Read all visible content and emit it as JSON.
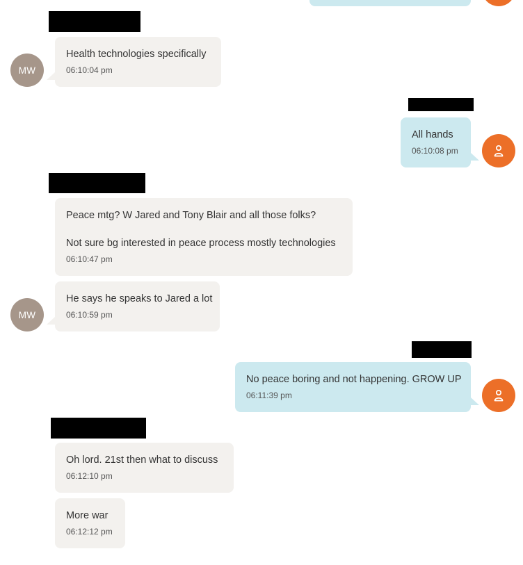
{
  "contact": {
    "initials": "MW"
  },
  "colors": {
    "incoming_bubble": "#f3f1ee",
    "outgoing_bubble": "#cce9ef",
    "contact_avatar": "#a6968a",
    "self_avatar": "#ec6f28",
    "redaction": "#000000"
  },
  "icons": {
    "self_avatar": "person-icon"
  },
  "messages": [
    {
      "direction": "outgoing",
      "text": "",
      "time": "",
      "partially_visible": true
    },
    {
      "direction": "incoming",
      "text": "Health technologies specifically",
      "time": "06:10:04 pm"
    },
    {
      "direction": "outgoing",
      "text": "All hands",
      "time": "06:10:08 pm"
    },
    {
      "direction": "incoming",
      "lines": [
        "Peace mtg? W Jared and Tony Blair and all those folks?",
        "Not sure bg interested in peace process mostly technologies"
      ],
      "time": "06:10:47 pm"
    },
    {
      "direction": "incoming",
      "text": "He says he speaks to Jared a lot",
      "time": "06:10:59 pm"
    },
    {
      "direction": "outgoing",
      "text": "No peace boring and not happening. GROW UP",
      "time": "06:11:39 pm"
    },
    {
      "direction": "incoming",
      "text": "Oh lord. 21st then what to discuss",
      "time": "06:12:10 pm"
    },
    {
      "direction": "incoming",
      "text": "More war",
      "time": "06:12:12 pm"
    }
  ]
}
